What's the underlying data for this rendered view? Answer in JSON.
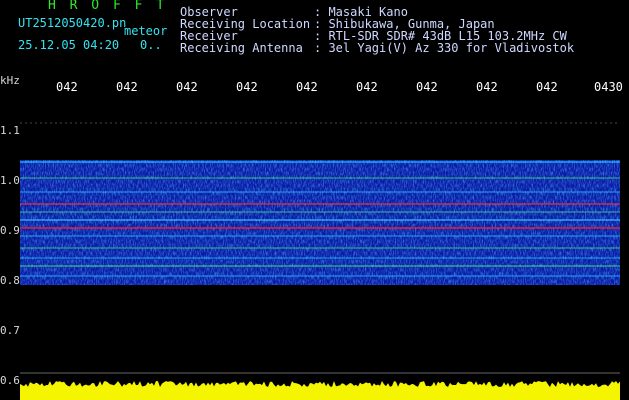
{
  "header": {
    "software": "H R O F F T",
    "filename": "UT2512050420.pn",
    "type_label": "meteor",
    "timestamp": "25.12.05 04:20",
    "count": "0.."
  },
  "metadata": [
    {
      "label": "Observer",
      "value": ": Masaki Kano"
    },
    {
      "label": "Receiving Location",
      "value": ": Shibukawa, Gunma, Japan"
    },
    {
      "label": "Receiver",
      "value": ": RTL-SDR SDR# 43dB L15 103.2MHz CW"
    },
    {
      "label": "Receiving Antenna",
      "value": ": 3el Yagi(V) Az 330 for Vladivostok"
    }
  ],
  "y_axis": {
    "unit": "kHz",
    "ticks": [
      "1.1",
      "1.0",
      "0.9",
      "0.8",
      "0.7",
      "0.6"
    ]
  },
  "x_axis": {
    "ticks": [
      "042",
      "042",
      "042",
      "042",
      "042",
      "042",
      "042",
      "042",
      "042",
      "0430"
    ]
  },
  "colors": {
    "background": "#000000",
    "title_green": "#2ee82e",
    "filename_cyan": "#35e3f0",
    "band_blue": "#0a1aa8",
    "level_yellow": "#f5f500",
    "line_red": "#ff2020"
  }
}
